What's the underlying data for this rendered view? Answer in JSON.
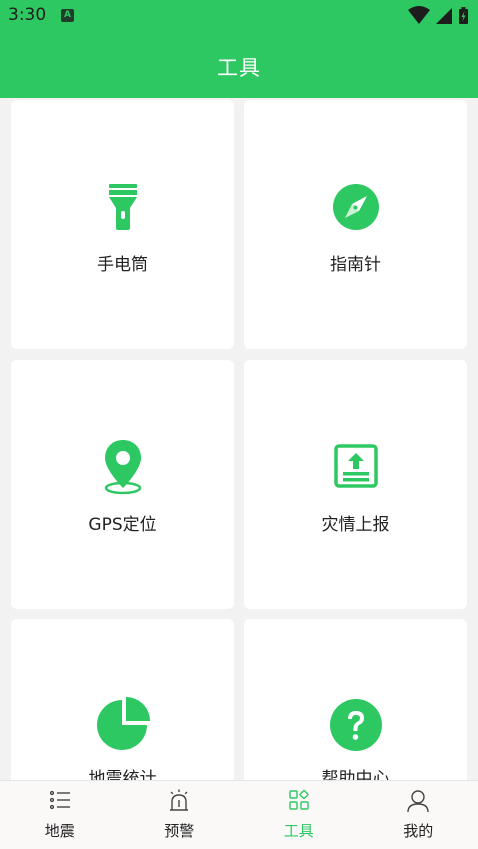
{
  "status_bar": {
    "time": "3:30",
    "notification_letter": "A"
  },
  "app_bar": {
    "title": "工具"
  },
  "tools": [
    {
      "label": "手电筒",
      "icon": "flashlight-icon"
    },
    {
      "label": "指南针",
      "icon": "compass-icon"
    },
    {
      "label": "GPS定位",
      "icon": "location-pin-icon"
    },
    {
      "label": "灾情上报",
      "icon": "upload-report-icon"
    },
    {
      "label": "地震统计",
      "icon": "pie-chart-icon"
    },
    {
      "label": "帮助中心",
      "icon": "help-icon"
    }
  ],
  "tab_bar": {
    "tabs": [
      {
        "label": "地震",
        "icon": "list-icon"
      },
      {
        "label": "预警",
        "icon": "alarm-icon"
      },
      {
        "label": "工具",
        "icon": "tools-grid-icon"
      },
      {
        "label": "我的",
        "icon": "person-icon"
      }
    ],
    "active": "工具"
  },
  "colors": {
    "accent": "#2ec862",
    "tab_bg": "#fbf9f8",
    "page_bg": "#f2f2f2"
  }
}
